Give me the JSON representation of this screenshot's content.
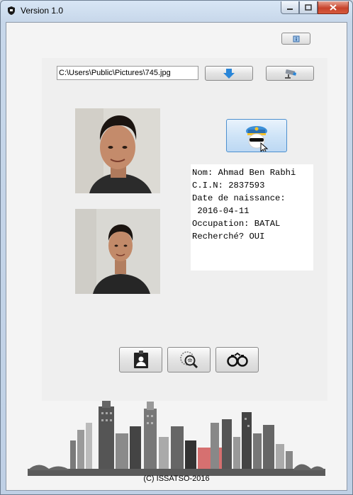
{
  "window": {
    "title": "Version 1.0"
  },
  "file": {
    "path_value": "C:\\Users\\Public\\Pictures\\745.jpg"
  },
  "person": {
    "nom": "Nom: Ahmad Ben Rabhi",
    "cin": "C.I.N: 2837593",
    "dob_label": "Date de naissance:",
    "dob_value": " 2016-04-11",
    "occupation": "Occupation: BATAL",
    "recherche": "Recherché? OUI"
  },
  "footer": {
    "copyright": "(C) ISSATSO-2016"
  },
  "icons": {
    "download": "download-arrow-icon",
    "camera": "security-camera-icon",
    "police": "police-officer-icon",
    "id_card": "id-card-icon",
    "search": "fingerprint-search-icon",
    "handcuffs": "handcuffs-icon"
  },
  "colors": {
    "accent_blue": "#2a86d8",
    "info_bg": "#ffffff"
  }
}
